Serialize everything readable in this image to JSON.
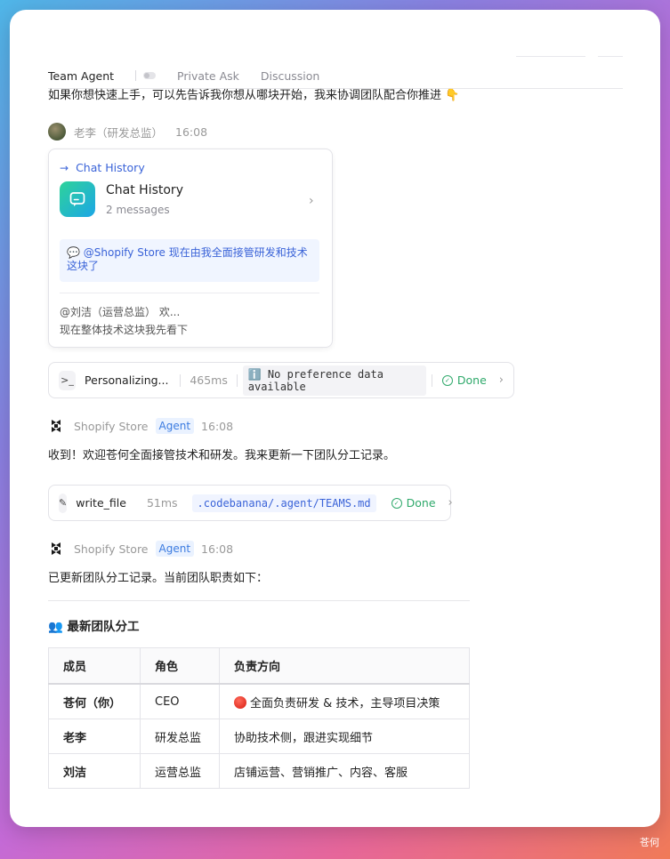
{
  "tabs": [
    "Team Agent",
    "Private Ask",
    "Discussion"
  ],
  "intro_text": "如果你想快速上手，可以先告诉我你想从哪块开始，我来协调团队配合你推进 👇",
  "message1": {
    "author": "老李（研发总监）",
    "time": "16:08",
    "card": {
      "header": "Chat History",
      "title": "Chat History",
      "subtitle": "2 messages",
      "quote": "💬 @Shopify Store 现在由我全面接管研发和技术这块了",
      "line1": "@刘洁（运营总监） 欢...",
      "line2": "现在整体技术这块我先看下"
    }
  },
  "tool1": {
    "icon": ">_",
    "name": "Personalizing...",
    "ms": "465ms",
    "result": "ℹ️ No preference data available",
    "status": "Done"
  },
  "message2": {
    "author": "Shopify Store",
    "badge": "Agent",
    "time": "16:08",
    "text": "收到！欢迎苍何全面接管技术和研发。我来更新一下团队分工记录。"
  },
  "tool2": {
    "icon": "✎",
    "name": "write_file",
    "ms": "51ms",
    "path": ".codebanana/.agent/TEAMS.md",
    "status": "Done"
  },
  "message3": {
    "author": "Shopify Store",
    "badge": "Agent",
    "time": "16:08",
    "text": "已更新团队分工记录。当前团队职责如下："
  },
  "section_title": "👥 最新团队分工",
  "table": {
    "headers": [
      "成员",
      "角色",
      "负责方向"
    ],
    "rows": [
      [
        "苍何（你）",
        "CEO",
        "全面负责研发 & 技术，主导项目决策"
      ],
      [
        "老李",
        "研发总监",
        "协助技术侧，跟进实现细节"
      ],
      [
        "刘洁",
        "运营总监",
        "店铺运营、营销推广、内容、客服"
      ]
    ]
  },
  "corner_label": "苍何",
  "colors": {
    "accent": "#3a63d8",
    "done": "#2fa96b",
    "agent_badge": "#3b7be0"
  }
}
